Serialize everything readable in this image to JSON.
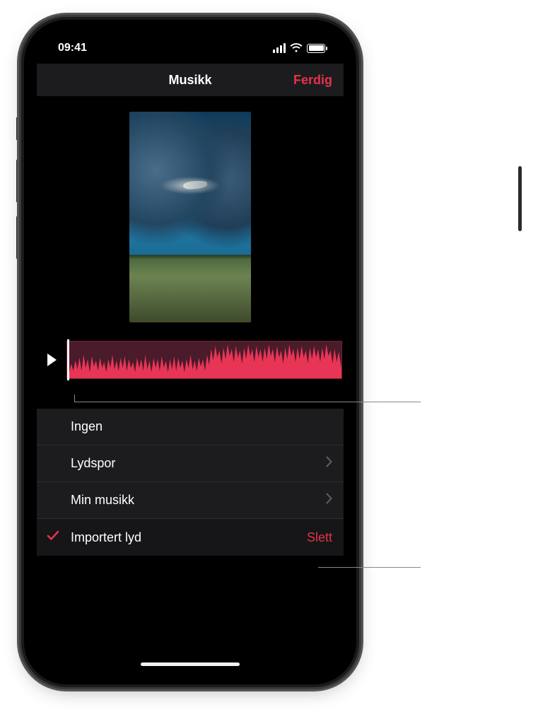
{
  "statusbar": {
    "time": "09:41"
  },
  "header": {
    "title": "Musikk",
    "done_label": "Ferdig"
  },
  "list": {
    "none_label": "Ingen",
    "soundtracks_label": "Lydspor",
    "my_music_label": "Min musikk",
    "imported_label": "Importert lyd",
    "delete_label": "Slett"
  }
}
